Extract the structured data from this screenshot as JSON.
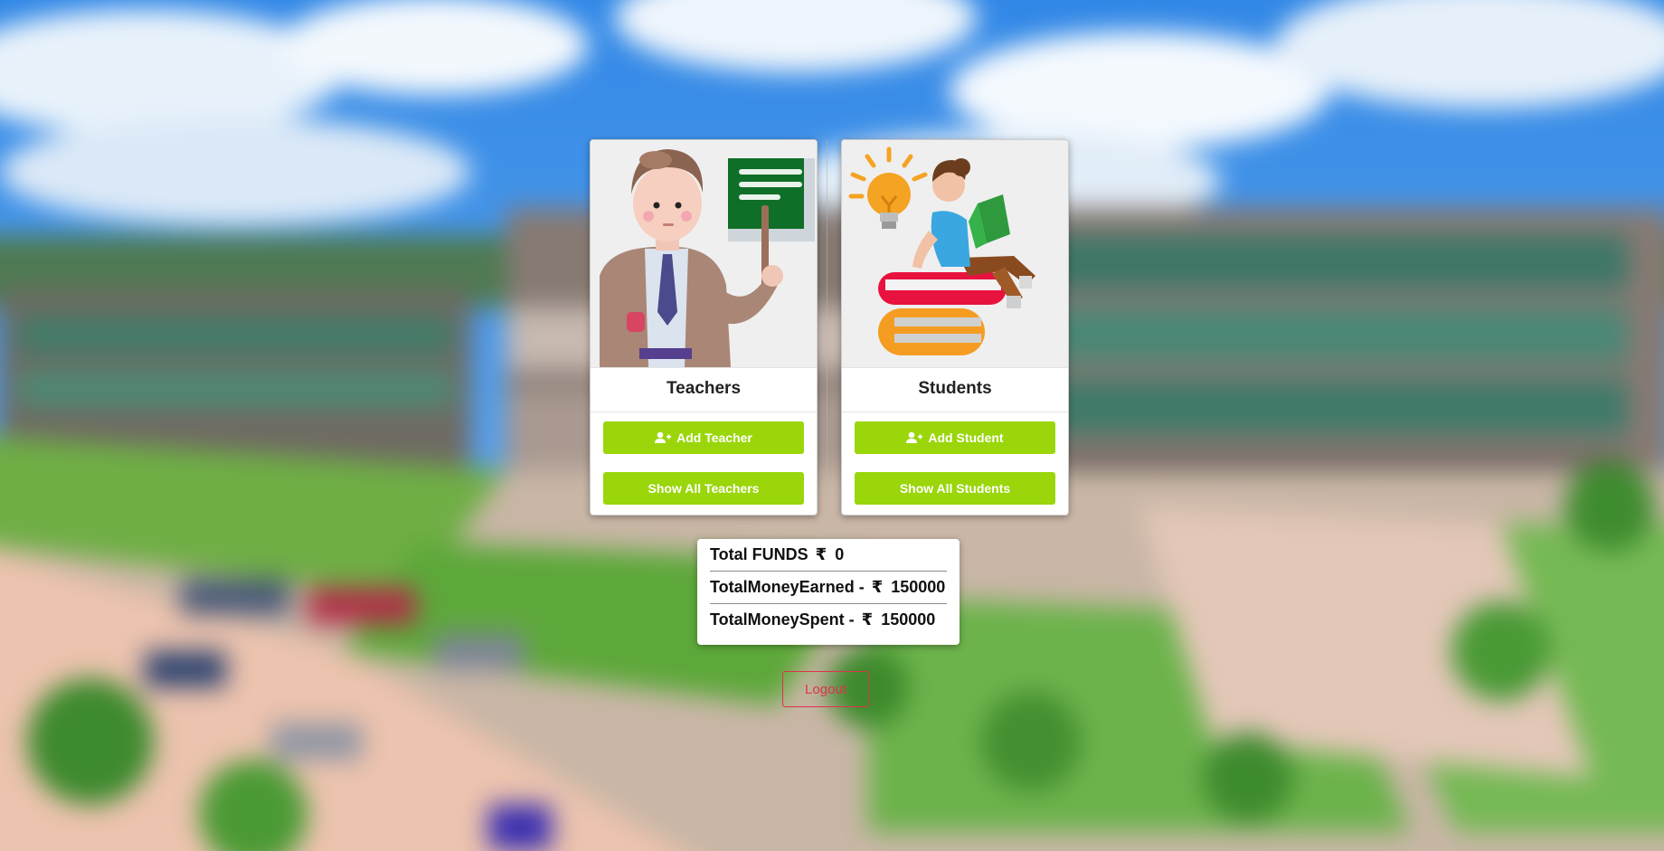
{
  "background": {
    "scene": "blurred-campus-building-photo",
    "sky_color": "#3d8fe0",
    "building_color": "#8a7e78",
    "lawn_color": "#5fa83a",
    "road_color": "#e8b9a4"
  },
  "cards": [
    {
      "title": "Teachers",
      "illustration": "teacher-illustration",
      "add_label": "Add Teacher",
      "add_icon": "user-plus-icon",
      "show_label": "Show All Teachers"
    },
    {
      "title": "Students",
      "illustration": "student-reading-illustration",
      "add_label": "Add Student",
      "add_icon": "user-plus-icon",
      "show_label": "Show All Students"
    }
  ],
  "funds": {
    "total_label": "Total FUNDS",
    "total_value": "0",
    "earned_label": "TotalMoneyEarned -",
    "earned_value": "150000",
    "spent_label": "TotalMoneySpent -",
    "spent_value": "150000",
    "currency_symbol": "₹"
  },
  "logout_label": "Logout",
  "colors": {
    "button_green": "#9ad60a",
    "logout_red": "#e0314b"
  }
}
